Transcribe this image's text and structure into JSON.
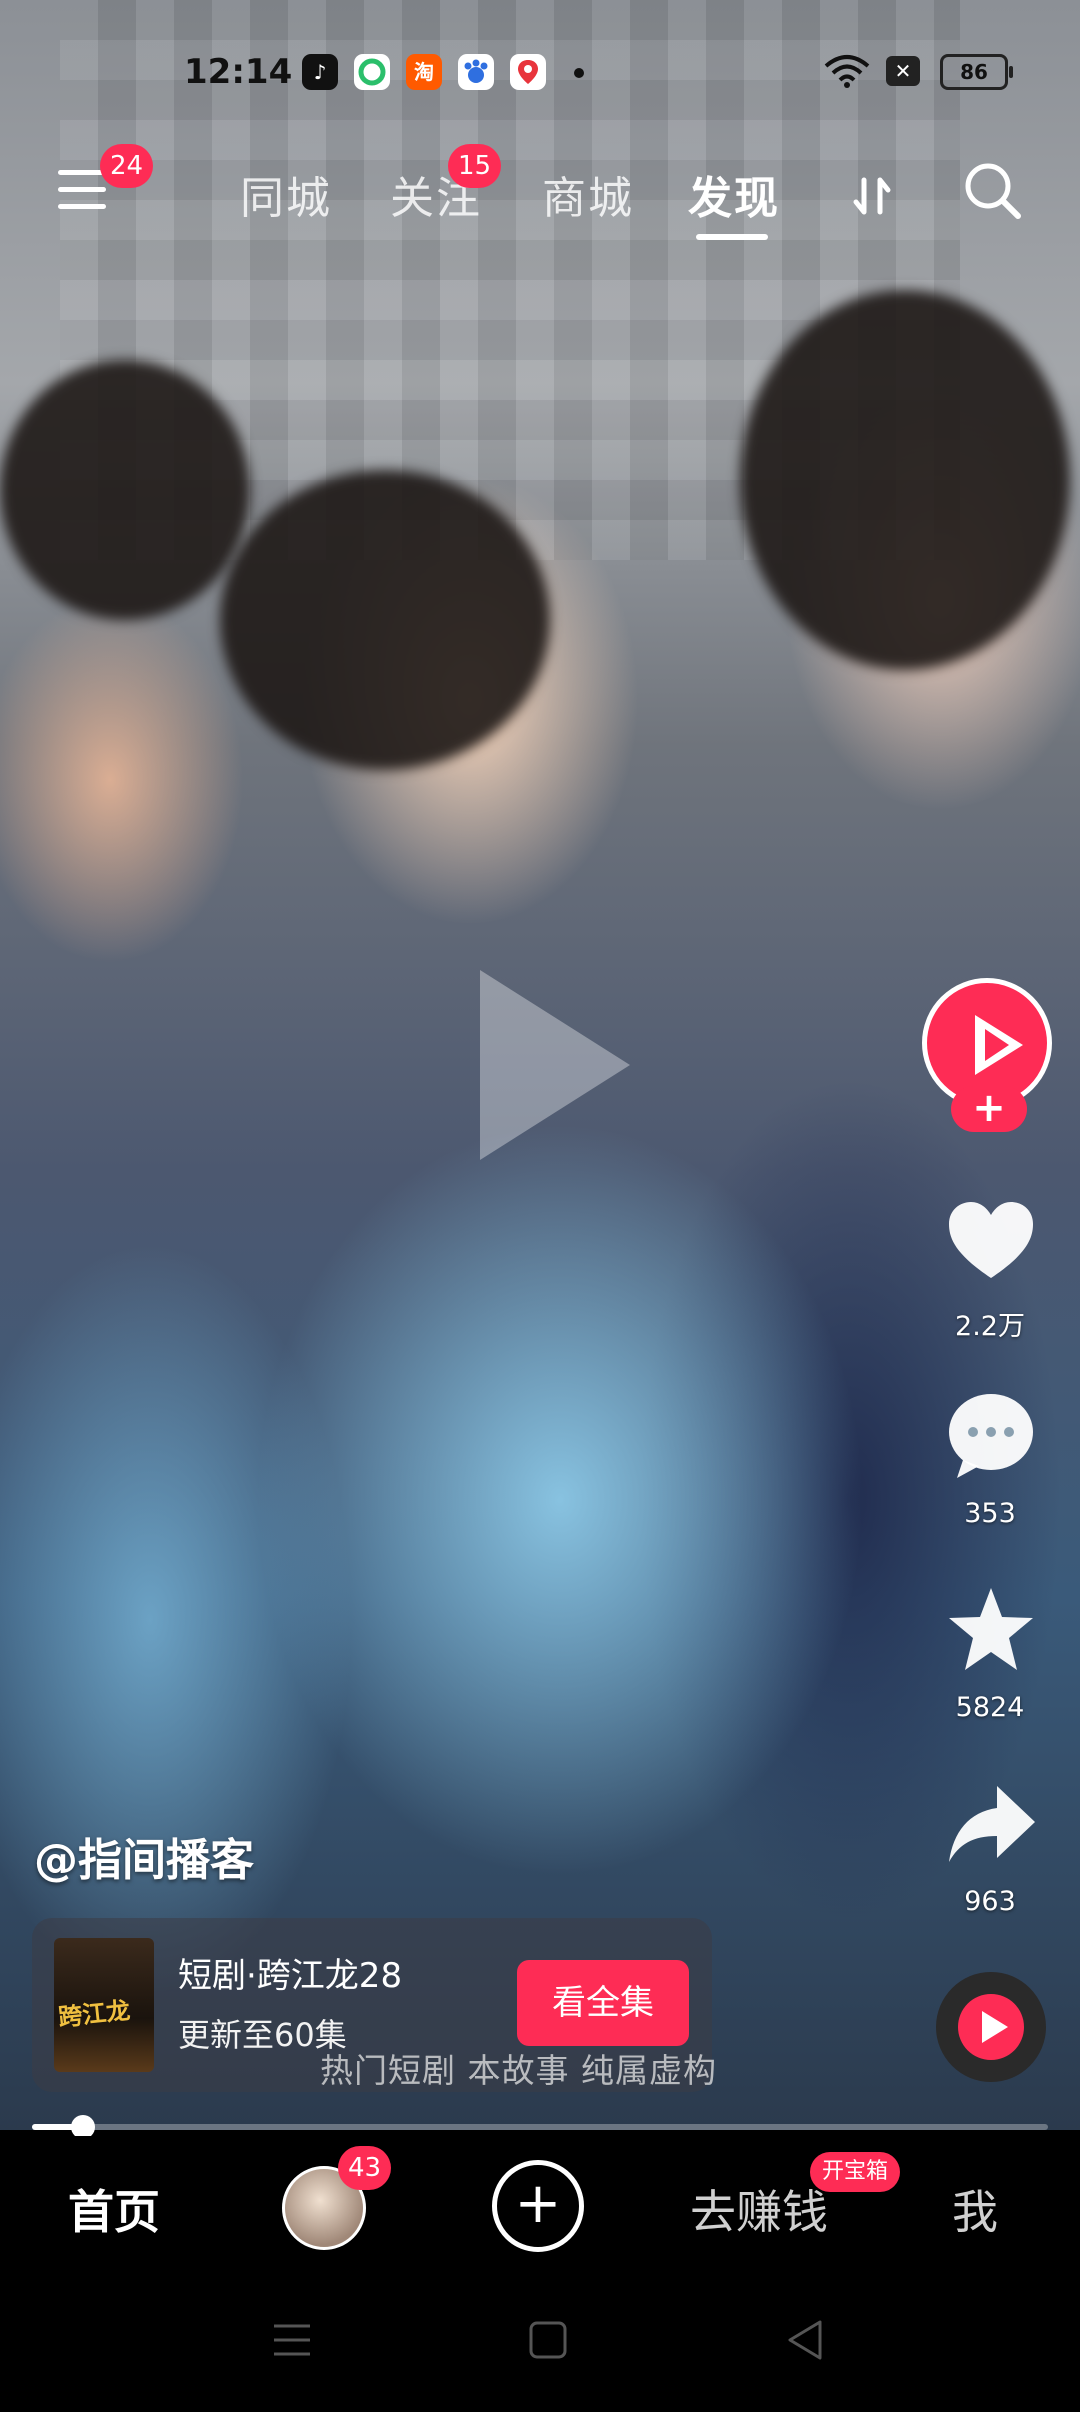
{
  "status_bar": {
    "time": "12:14",
    "apps": [
      "tiktok-icon",
      "green-app-icon",
      "taobao-icon",
      "baidu-icon",
      "map-icon"
    ],
    "taobao_label": "淘",
    "battery": "86"
  },
  "top_nav": {
    "menu_badge": "24",
    "tabs": [
      {
        "label": "同城"
      },
      {
        "label": "关注",
        "badge": "15"
      },
      {
        "label": "商城"
      },
      {
        "label": "发现",
        "active": true
      }
    ]
  },
  "right_rail": {
    "likes": "2.2万",
    "comments": "353",
    "favorites": "5824",
    "shares": "963"
  },
  "video": {
    "author": "@指间播客",
    "drama_title": "短剧·跨江龙28",
    "drama_subtitle": "更新至60集",
    "watch_button": "看全集",
    "poster_text": "跨江龙",
    "subtitle_line": "热门短剧 本故事 纯属虚构",
    "progress": 0.05
  },
  "bottom_nav": {
    "home": "首页",
    "avatar_badge": "43",
    "plus": "+",
    "earn": "去赚钱",
    "earn_badge": "开宝箱",
    "me": "我"
  },
  "colors": {
    "accent": "#fe2c55"
  }
}
